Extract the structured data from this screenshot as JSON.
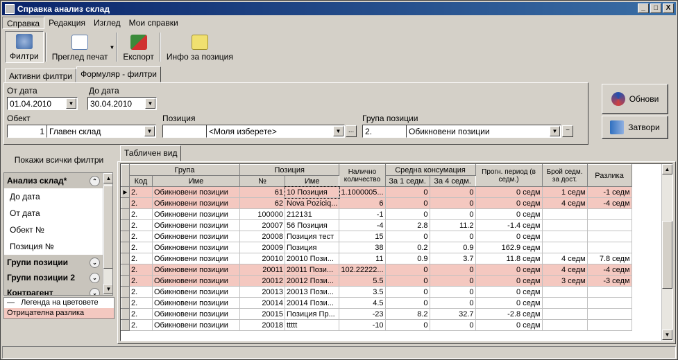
{
  "window": {
    "title": "Справка анализ склад"
  },
  "titlebar_buttons": [
    "_",
    "□",
    "X"
  ],
  "menu": [
    "Справка",
    "Редакция",
    "Изглед",
    "Мои справки"
  ],
  "toolbar": {
    "filters": "Филтри",
    "preview": "Преглед печат",
    "export": "Експорт",
    "position_info": "Инфо за позиция"
  },
  "filter_tabs": [
    "Активни филтри",
    "Формуляр - филтри"
  ],
  "form": {
    "from_date_label": "От дата",
    "from_date": "01.04.2010",
    "to_date_label": "До дата",
    "to_date": "30.04.2010",
    "object_label": "Обект",
    "object_code": "1",
    "object_name": "Главен склад",
    "position_label": "Позиция",
    "position_code": "",
    "position_name": "<Моля изберете>",
    "group_label": "Група позиции",
    "group_code": "2.",
    "group_name": "Обикновени позиции",
    "ellipsis": "...",
    "minus": "−"
  },
  "buttons": {
    "refresh": "Обнови",
    "close": "Затвори"
  },
  "left": {
    "show_all": "Покажи всички филтри",
    "groups": [
      {
        "title": "Анализ склад*",
        "chev": "⌃",
        "items": [
          "До дата",
          "От дата",
          "Обект №",
          "Позиция №"
        ]
      },
      {
        "title": "Групи позиции",
        "chev": "⌄",
        "items": []
      },
      {
        "title": "Групи позиции 2",
        "chev": "⌄",
        "items": []
      },
      {
        "title": "Контрагент",
        "chev": "⌄",
        "items": []
      }
    ],
    "legend_title": "Легенда на цветовете",
    "legend_dash": "—",
    "legend_item": "Отрицателна разлика"
  },
  "grid_tab": "Табличен вид",
  "grid": {
    "group_header": "Група",
    "position_header": "Позиция",
    "qty_header": "Налично количество",
    "avg_header": "Средна консумация",
    "period_header": "Прогн. период (в седм.)",
    "weeks_header": "Брой седм. за дост.",
    "diff_header": "Разлика",
    "sub_code": "Код",
    "sub_name": "Име",
    "sub_no": "№",
    "sub_pname": "Име",
    "sub_w1": "За 1 седм.",
    "sub_w4": "За 4 седм.",
    "rows": [
      {
        "code": "2.",
        "gname": "Обикновени позиции",
        "no": "61",
        "pname": "10 Позиция",
        "qty": "1.1000005...",
        "w1": "0",
        "w4": "0",
        "period": "0 седм",
        "weeks": "1 седм",
        "diff": "-1 седм",
        "neg": true,
        "current": true
      },
      {
        "code": "2.",
        "gname": "Обикновени позиции",
        "no": "62",
        "pname": "Nova Poziciq...",
        "qty": "6",
        "w1": "0",
        "w4": "0",
        "period": "0 седм",
        "weeks": "4 седм",
        "diff": "-4 седм",
        "neg": true
      },
      {
        "code": "2.",
        "gname": "Обикновени позиции",
        "no": "100000",
        "pname": "212131",
        "qty": "-1",
        "w1": "0",
        "w4": "0",
        "period": "0 седм",
        "weeks": "",
        "diff": ""
      },
      {
        "code": "2.",
        "gname": "Обикновени позиции",
        "no": "20007",
        "pname": "56 Позиция",
        "qty": "-4",
        "w1": "2.8",
        "w4": "11.2",
        "period": "-1.4 седм",
        "weeks": "",
        "diff": ""
      },
      {
        "code": "2.",
        "gname": "Обикновени позиции",
        "no": "20008",
        "pname": "Позиция тест",
        "qty": "15",
        "w1": "0",
        "w4": "0",
        "period": "0 седм",
        "weeks": "",
        "diff": ""
      },
      {
        "code": "2.",
        "gname": "Обикновени позиции",
        "no": "20009",
        "pname": "Позиция",
        "qty": "38",
        "w1": "0.2",
        "w4": "0.9",
        "period": "162.9 седм",
        "weeks": "",
        "diff": ""
      },
      {
        "code": "2.",
        "gname": "Обикновени позиции",
        "no": "20010",
        "pname": "20010 Пози...",
        "qty": "11",
        "w1": "0.9",
        "w4": "3.7",
        "period": "11.8 седм",
        "weeks": "4 седм",
        "diff": "7.8 седм"
      },
      {
        "code": "2.",
        "gname": "Обикновени позиции",
        "no": "20011",
        "pname": "20011 Пози...",
        "qty": "102.22222...",
        "w1": "0",
        "w4": "0",
        "period": "0 седм",
        "weeks": "4 седм",
        "diff": "-4 седм",
        "neg": true
      },
      {
        "code": "2.",
        "gname": "Обикновени позиции",
        "no": "20012",
        "pname": "20012 Пози...",
        "qty": "5.5",
        "w1": "0",
        "w4": "0",
        "period": "0 седм",
        "weeks": "3 седм",
        "diff": "-3 седм",
        "neg": true
      },
      {
        "code": "2.",
        "gname": "Обикновени позиции",
        "no": "20013",
        "pname": "20013 Пози...",
        "qty": "3.5",
        "w1": "0",
        "w4": "0",
        "period": "0 седм",
        "weeks": "",
        "diff": ""
      },
      {
        "code": "2.",
        "gname": "Обикновени позиции",
        "no": "20014",
        "pname": "20014 Пози...",
        "qty": "4.5",
        "w1": "0",
        "w4": "0",
        "period": "0 седм",
        "weeks": "",
        "diff": ""
      },
      {
        "code": "2.",
        "gname": "Обикновени позиции",
        "no": "20015",
        "pname": "Позиция Пр...",
        "qty": "-23",
        "w1": "8.2",
        "w4": "32.7",
        "period": "-2.8 седм",
        "weeks": "",
        "diff": ""
      },
      {
        "code": "2.",
        "gname": "Обикновени позиции",
        "no": "20018",
        "pname": "ttttt",
        "qty": "-10",
        "w1": "0",
        "w4": "0",
        "period": "0 седм",
        "weeks": "",
        "diff": ""
      }
    ]
  },
  "colors": {
    "negative_row": "#f4c8c0",
    "title_start": "#0a246a",
    "title_end": "#3a6ea5"
  }
}
